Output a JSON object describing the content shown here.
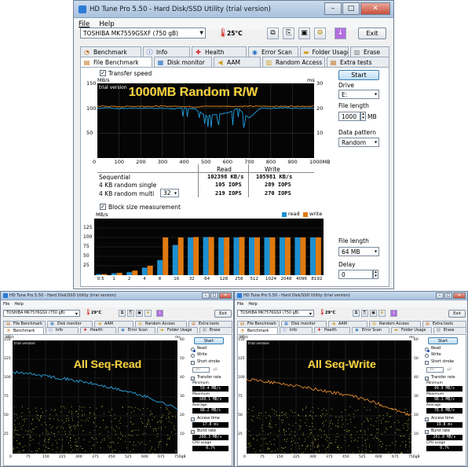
{
  "main": {
    "title": "HD Tune Pro 5.50 - Hard Disk/SSD Utility (trial version)",
    "menu": [
      "File",
      "Help"
    ],
    "drive_select": "TOSHIBA MK7559GSXF (750 gB)",
    "temperature": "25°C",
    "exit_label": "Exit",
    "tabs_row1": [
      "Benchmark",
      "Info",
      "Health",
      "Error Scan",
      "Folder Usage",
      "Erase"
    ],
    "tabs_row2": [
      "File Benchmark",
      "Disk monitor",
      "AAM",
      "Random Access",
      "Extra tests"
    ],
    "transfer_speed_label": "Transfer speed",
    "chart1": {
      "trial_label": "trial version",
      "caption": "1000MB Random R/W",
      "left_unit": "MB/s",
      "right_unit": "ms",
      "y_left_ticks": [
        "150",
        "100",
        "50",
        ""
      ],
      "y_right_ticks": [
        "30",
        "20",
        "10",
        ""
      ],
      "x_ticks": [
        "0",
        "100",
        "200",
        "300",
        "400",
        "500",
        "600",
        "700",
        "800",
        "900",
        "1000MB"
      ]
    },
    "results": {
      "col_read": "Read",
      "col_write": "Write",
      "rows": [
        {
          "label": "Sequential",
          "read": "102398 KB/s",
          "write": "105981 KB/s"
        },
        {
          "label": "4 KB random single",
          "read": "105 IOPS",
          "write": "289 IOPS"
        },
        {
          "label": "4 KB random multi",
          "read": "219 IOPS",
          "write": "270 IOPS"
        }
      ],
      "multi_depth": "32"
    },
    "right_panel": {
      "start_label": "Start",
      "drive_label": "Drive",
      "drive_value": "E:",
      "file_length_label": "File length",
      "file_length_value": "1000",
      "file_length_unit": "MB",
      "data_pattern_label": "Data pattern",
      "data_pattern_value": "Random",
      "file_length2_label": "File length",
      "file_length2_value": "64 MB",
      "delay_label": "Delay",
      "delay_value": "0"
    },
    "block_size_label": "Block size measurement",
    "chart2": {
      "unit": "MB/s",
      "legend_read": "read",
      "legend_write": "write",
      "y_ticks": [
        "125",
        "100",
        "75",
        "50",
        "25"
      ],
      "x_ticks": [
        "0.5",
        "1",
        "2",
        "4",
        "8",
        "16",
        "32",
        "64",
        "128",
        "256",
        "512",
        "1024",
        "2048",
        "4096",
        "8192"
      ],
      "read_color": "#1e90d0",
      "write_color": "#e07a10"
    }
  },
  "left": {
    "title": "HD Tune Pro 5.50 - Hard Disk/SSD Utility (trial version)",
    "menu": [
      "File",
      "Help"
    ],
    "drive_select": "TOSHIBA MK7576GSX (750 gB)",
    "temperature": "29°C",
    "exit_label": "Exit",
    "tabs_row1": [
      "File Benchmark",
      "Disk monitor",
      "AAM",
      "Random Access",
      "Extra tests"
    ],
    "tabs_row2": [
      "Benchmark",
      "Info",
      "Health",
      "Error Scan",
      "Folder Usage",
      "Erase"
    ],
    "caption": "All Seq-Read",
    "trial_label": "trial version",
    "unit_left": "MB/s",
    "unit_right": "ms",
    "y_left_ticks": [
      "150",
      "125",
      "100",
      "75",
      "50",
      "25"
    ],
    "y_right_ticks": [
      "60",
      "50",
      "40",
      "30",
      "20",
      "10"
    ],
    "x_ticks": [
      "0",
      "75",
      "150",
      "225",
      "300",
      "375",
      "450",
      "525",
      "600",
      "675",
      "750gB"
    ],
    "side": {
      "start_label": "Start",
      "read_label": "Read",
      "write_label": "Write",
      "short_stroke_label": "Short stroke",
      "short_stroke_value": "40",
      "short_stroke_unit": "gB",
      "transfer_rate_label": "Transfer rate",
      "minimum_label": "Minimum",
      "minimum_value": "59.4 MB/s",
      "maximum_label": "Maximum",
      "maximum_value": "108.1 MB/s",
      "average_label": "Average",
      "average_value": "88.2 MB/s",
      "access_time_label": "Access time",
      "access_time_value": "17.8 ms",
      "burst_rate_label": "Burst rate",
      "burst_rate_value": "208.3 MB/s",
      "cpu_label": "CPU usage",
      "cpu_value": "0.7%"
    }
  },
  "right": {
    "title": "HD Tune Pro 5.50 - Hard Disk/SSD Utility (trial version)",
    "menu": [
      "File",
      "Help"
    ],
    "drive_select": "TOSHIBA MK7576GSX (750 gB)",
    "temperature": "29°C",
    "exit_label": "Exit",
    "tabs_row1": [
      "File Benchmark",
      "Disk monitor",
      "AAM",
      "Random Access",
      "Extra tests"
    ],
    "tabs_row2": [
      "Benchmark",
      "Info",
      "Health",
      "Error Scan",
      "Folder Usage",
      "Erase"
    ],
    "caption": "All Seq-Write",
    "trial_label": "trial version",
    "unit_left": "MB/s",
    "unit_right": "ms",
    "y_left_ticks": [
      "150",
      "125",
      "100",
      "75",
      "50",
      "25"
    ],
    "y_right_ticks": [
      "60",
      "50",
      "40",
      "30",
      "20",
      "10"
    ],
    "x_ticks": [
      "0",
      "75",
      "150",
      "225",
      "300",
      "375",
      "450",
      "525",
      "600",
      "675",
      "750gB"
    ],
    "side": {
      "start_label": "Start",
      "read_label": "Read",
      "write_label": "Write",
      "short_stroke_label": "Short stroke",
      "short_stroke_value": "40",
      "short_stroke_unit": "gB",
      "transfer_rate_label": "Transfer rate",
      "minimum_label": "Minimum",
      "minimum_value": "49.9 MB/s",
      "maximum_label": "Maximum",
      "maximum_value": "98.1 MB/s",
      "average_label": "Average",
      "average_value": "78.6 MB/s",
      "access_time_label": "Access time",
      "access_time_value": "19.8 ms",
      "burst_rate_label": "Burst rate",
      "burst_rate_value": "201.8 MB/s",
      "cpu_label": "CPU usage",
      "cpu_value": "0.7%"
    }
  },
  "chart_data": [
    {
      "type": "line",
      "title": "1000MB Random R/W",
      "xlabel": "",
      "ylabel": "MB/s",
      "xlim": [
        0,
        1000
      ],
      "ylim": [
        0,
        150
      ],
      "y2lim": [
        0,
        30
      ],
      "series": [
        {
          "color": "#1ea0e0",
          "x": [
            0,
            50,
            100,
            150,
            200,
            250,
            300,
            350,
            400,
            450,
            500,
            550,
            600,
            650,
            700,
            750,
            800,
            850,
            900,
            950,
            1000
          ],
          "values": [
            100,
            101,
            99,
            100,
            100,
            100,
            100,
            99,
            100,
            99,
            85,
            88,
            90,
            100,
            80,
            100,
            100,
            101,
            100,
            100,
            100
          ]
        },
        {
          "color": "#e08a20",
          "x": [
            0,
            50,
            100,
            150,
            200,
            250,
            300,
            350,
            400,
            450,
            500,
            550,
            600,
            650,
            700,
            750,
            800,
            850,
            900,
            950,
            1000
          ],
          "values": [
            104,
            104,
            103,
            104,
            104,
            104,
            104,
            104,
            104,
            103,
            104,
            104,
            104,
            104,
            104,
            104,
            104,
            104,
            104,
            104,
            104
          ]
        }
      ]
    },
    {
      "type": "bar",
      "title": "",
      "xlabel": "",
      "ylabel": "MB/s",
      "ylim": [
        0,
        150
      ],
      "categories": [
        "0.5",
        "1",
        "2",
        "4",
        "8",
        "16",
        "32",
        "64",
        "128",
        "256",
        "512",
        "1024",
        "2048",
        "4096",
        "8192"
      ],
      "series": [
        {
          "name": "read",
          "color": "#1e90d0",
          "values": [
            3,
            5,
            8,
            20,
            40,
            80,
            100,
            101,
            100,
            100,
            100,
            100,
            100,
            100,
            100
          ]
        },
        {
          "name": "write",
          "color": "#e07a10",
          "values": [
            3,
            6,
            12,
            25,
            100,
            100,
            101,
            101,
            100,
            101,
            100,
            100,
            100,
            100,
            100
          ]
        }
      ]
    },
    {
      "type": "line",
      "title": "All Seq-Read",
      "xlabel": "",
      "ylabel": "MB/s",
      "xlim": [
        0,
        750
      ],
      "ylim": [
        0,
        150
      ],
      "series": [
        {
          "color": "#2aa0d8",
          "x": [
            0,
            75,
            150,
            225,
            300,
            375,
            450,
            525,
            600,
            675,
            750
          ],
          "values": [
            108,
            106,
            103,
            100,
            96,
            92,
            87,
            82,
            76,
            68,
            60
          ]
        }
      ]
    },
    {
      "type": "line",
      "title": "All Seq-Write",
      "xlabel": "",
      "ylabel": "MB/s",
      "xlim": [
        0,
        750
      ],
      "ylim": [
        0,
        150
      ],
      "series": [
        {
          "color": "#e08a30",
          "x": [
            0,
            75,
            150,
            225,
            300,
            375,
            450,
            525,
            600,
            675,
            750
          ],
          "values": [
            98,
            96,
            93,
            90,
            86,
            82,
            78,
            73,
            66,
            58,
            50
          ]
        }
      ]
    }
  ]
}
